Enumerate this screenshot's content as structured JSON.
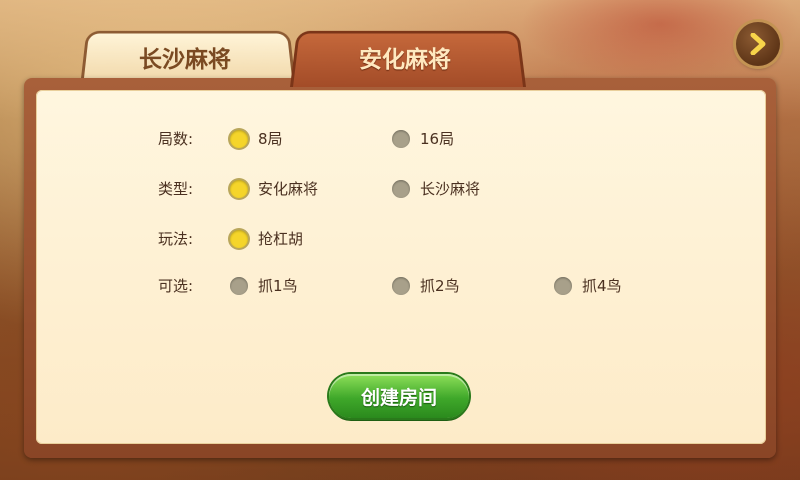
{
  "tabs": [
    {
      "label": "长沙麻将",
      "active": false
    },
    {
      "label": "安化麻将",
      "active": true
    }
  ],
  "nav": {
    "next_icon": "chevron-right-icon"
  },
  "options": {
    "rounds": {
      "label": "局数:",
      "choices": [
        {
          "label": "8局",
          "selected": true
        },
        {
          "label": "16局",
          "selected": false
        }
      ]
    },
    "type": {
      "label": "类型:",
      "choices": [
        {
          "label": "安化麻将",
          "selected": true
        },
        {
          "label": "长沙麻将",
          "selected": false
        }
      ]
    },
    "play": {
      "label": "玩法:",
      "choices": [
        {
          "label": "抢杠胡",
          "selected": true
        }
      ]
    },
    "extras": {
      "label": "可选:",
      "choices": [
        {
          "label": "抓1鸟",
          "selected": false
        },
        {
          "label": "抓2鸟",
          "selected": false
        },
        {
          "label": "抓4鸟",
          "selected": false
        }
      ]
    }
  },
  "create_button": {
    "label": "创建房间"
  },
  "colors": {
    "accent_green": "#3fa82a",
    "radio_selected": "#f5d52a",
    "radio_unselected": "#a8a08a",
    "tab_active": "#b0552d"
  }
}
